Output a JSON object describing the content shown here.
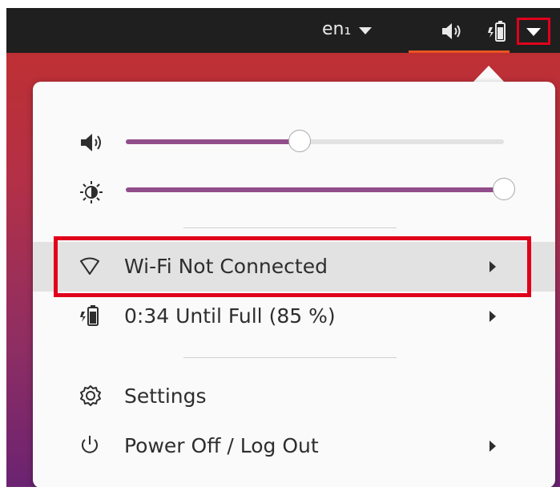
{
  "topbar": {
    "language": "en₁",
    "icons": [
      "speaker-icon",
      "battery-charging-icon",
      "system-menu-arrow-icon"
    ]
  },
  "popup": {
    "sliders": [
      {
        "name": "volume",
        "icon": "speaker-icon",
        "value": 0.46
      },
      {
        "name": "brightness",
        "icon": "brightness-icon",
        "value": 1.0
      }
    ],
    "items": [
      {
        "id": "wifi",
        "icon": "wifi-icon",
        "label": "Wi-Fi Not Connected",
        "has_submenu": true,
        "highlighted": true
      },
      {
        "id": "battery",
        "icon": "battery-charging-icon",
        "label": "0:34 Until Full (85 %)",
        "has_submenu": true
      },
      {
        "id": "settings",
        "icon": "gear-icon",
        "label": "Settings",
        "has_submenu": false
      },
      {
        "id": "power",
        "icon": "power-icon",
        "label": "Power Off / Log Out",
        "has_submenu": true
      }
    ]
  },
  "colors": {
    "slider_fill": "#924d8b",
    "annotation": "#e0001b",
    "highlight": "#e2e2e2",
    "accent": "#e95420"
  }
}
